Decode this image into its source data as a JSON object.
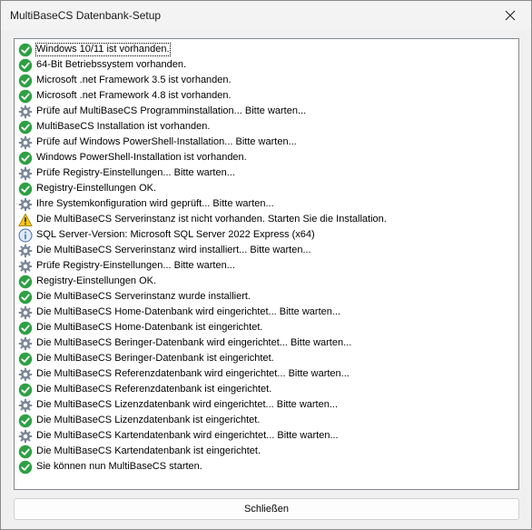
{
  "window": {
    "title": "MultiBaseCS Datenbank-Setup",
    "close_glyph": "✕"
  },
  "log": [
    {
      "icon": "check-icon",
      "text": "Windows 10/11 ist vorhanden."
    },
    {
      "icon": "check-icon",
      "text": "64-Bit Betriebssystem vorhanden."
    },
    {
      "icon": "check-icon",
      "text": "Microsoft .net Framework 3.5 ist vorhanden."
    },
    {
      "icon": "check-icon",
      "text": "Microsoft .net Framework 4.8 ist vorhanden."
    },
    {
      "icon": "gear-icon",
      "text": "Prüfe auf MultiBaseCS Programminstallation... Bitte warten..."
    },
    {
      "icon": "check-icon",
      "text": "MultiBaseCS Installation ist vorhanden."
    },
    {
      "icon": "gear-icon",
      "text": "Prüfe auf Windows PowerShell-Installation... Bitte warten..."
    },
    {
      "icon": "check-icon",
      "text": "Windows PowerShell-Installation ist vorhanden."
    },
    {
      "icon": "gear-icon",
      "text": "Prüfe Registry-Einstellungen... Bitte warten..."
    },
    {
      "icon": "check-icon",
      "text": "Registry-Einstellungen OK."
    },
    {
      "icon": "gear-icon",
      "text": "Ihre Systemkonfiguration wird geprüft... Bitte warten..."
    },
    {
      "icon": "warning-icon",
      "text": "Die MultiBaseCS Serverinstanz ist nicht vorhanden. Starten Sie die Installation."
    },
    {
      "icon": "info-icon",
      "text": "SQL Server-Version: Microsoft SQL Server 2022 Express (x64)"
    },
    {
      "icon": "gear-icon",
      "text": "Die MultiBaseCS Serverinstanz wird installiert... Bitte warten..."
    },
    {
      "icon": "gear-icon",
      "text": "Prüfe Registry-Einstellungen... Bitte warten..."
    },
    {
      "icon": "check-icon",
      "text": "Registry-Einstellungen OK."
    },
    {
      "icon": "check-icon",
      "text": "Die MultiBaseCS Serverinstanz wurde installiert."
    },
    {
      "icon": "gear-icon",
      "text": "Die MultiBaseCS Home-Datenbank wird eingerichtet... Bitte warten..."
    },
    {
      "icon": "check-icon",
      "text": "Die MultiBaseCS Home-Datenbank ist eingerichtet."
    },
    {
      "icon": "gear-icon",
      "text": "Die MultiBaseCS Beringer-Datenbank wird eingerichtet... Bitte warten..."
    },
    {
      "icon": "check-icon",
      "text": "Die MultiBaseCS Beringer-Datenbank ist eingerichtet."
    },
    {
      "icon": "gear-icon",
      "text": "Die MultiBaseCS Referenzdatenbank wird eingerichtet... Bitte warten..."
    },
    {
      "icon": "check-icon",
      "text": "Die MultiBaseCS Referenzdatenbank ist eingerichtet."
    },
    {
      "icon": "gear-icon",
      "text": "Die MultiBaseCS Lizenzdatenbank wird eingerichtet... Bitte warten..."
    },
    {
      "icon": "check-icon",
      "text": "Die MultiBaseCS Lizenzdatenbank ist eingerichtet."
    },
    {
      "icon": "gear-icon",
      "text": "Die MultiBaseCS Kartendatenbank wird eingerichtet... Bitte warten..."
    },
    {
      "icon": "check-icon",
      "text": "Die MultiBaseCS Kartendatenbank ist eingerichtet."
    },
    {
      "icon": "check-icon",
      "text": "Sie können nun MultiBaseCS starten."
    }
  ],
  "buttons": {
    "close_label": "Schließen"
  },
  "colors": {
    "check": "#2ea043",
    "gear": "#7a8799",
    "warning": "#f5c518",
    "info": "#4a6fa5"
  }
}
